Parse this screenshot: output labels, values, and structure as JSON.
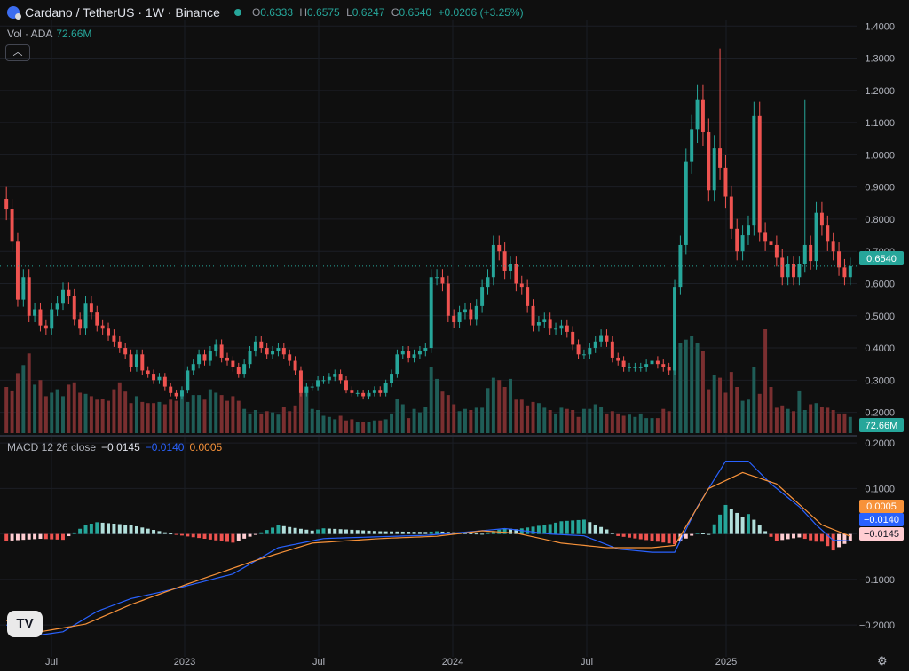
{
  "header": {
    "title": "Cardano / TetherUS · 1W · Binance",
    "o_label": "O",
    "o": "0.6333",
    "h_label": "H",
    "h": "0.6575",
    "l_label": "L",
    "l": "0.6247",
    "c_label": "C",
    "c": "0.6540",
    "change": "+0.0206 (+3.25%)"
  },
  "volume_legend": {
    "label": "Vol · ADA",
    "value": "72.66M"
  },
  "macd_legend": {
    "label": "MACD 12 26 close",
    "macd": "−0.0145",
    "signal": "−0.0140",
    "hist": "0.0005"
  },
  "badges": {
    "price": "0.6540",
    "volume": "72.66M",
    "macd_hist": "0.0005",
    "macd_signal": "−0.0140",
    "macd": "−0.0145"
  },
  "colors": {
    "up": "#26a69a",
    "down": "#ef5350",
    "vol_up": "#1f5d57",
    "vol_down": "#7a2f30",
    "macd_line": "#2962ff",
    "signal_line": "#f7923a",
    "hist_up_strong": "#26a69a",
    "hist_up_weak": "#b2dfdb",
    "hist_down_strong": "#ef5350",
    "hist_down_weak": "#ffcdd2",
    "bg": "#0f0f0f"
  },
  "chart_data": {
    "type": "candlestick",
    "interval": "1W",
    "x_labels": [
      "Jul",
      "2023",
      "Jul",
      "2024",
      "Jul",
      "2025"
    ],
    "price_axis": [
      "1.4000",
      "1.3000",
      "1.2000",
      "1.1000",
      "1.0000",
      "0.9000",
      "0.8000",
      "0.7000",
      "0.6000",
      "0.5000",
      "0.4000",
      "0.3000",
      "0.2000"
    ],
    "price_range": [
      0.13,
      1.42
    ],
    "last_price": 0.654,
    "macd_axis": [
      "0.2000",
      "0.1000",
      "0.0000",
      "−0.1000",
      "−0.2000"
    ],
    "macd_range": [
      -0.27,
      0.21
    ],
    "closes": [
      0.83,
      0.73,
      0.55,
      0.62,
      0.5,
      0.52,
      0.47,
      0.46,
      0.52,
      0.54,
      0.58,
      0.56,
      0.49,
      0.46,
      0.54,
      0.51,
      0.47,
      0.46,
      0.44,
      0.42,
      0.4,
      0.38,
      0.34,
      0.38,
      0.33,
      0.32,
      0.3,
      0.31,
      0.28,
      0.26,
      0.25,
      0.27,
      0.33,
      0.35,
      0.38,
      0.36,
      0.39,
      0.41,
      0.37,
      0.36,
      0.34,
      0.32,
      0.35,
      0.39,
      0.42,
      0.4,
      0.38,
      0.39,
      0.4,
      0.38,
      0.36,
      0.33,
      0.26,
      0.28,
      0.28,
      0.3,
      0.3,
      0.31,
      0.32,
      0.3,
      0.27,
      0.26,
      0.26,
      0.25,
      0.26,
      0.27,
      0.26,
      0.29,
      0.32,
      0.38,
      0.39,
      0.37,
      0.38,
      0.39,
      0.4,
      0.62,
      0.62,
      0.6,
      0.5,
      0.48,
      0.51,
      0.52,
      0.49,
      0.53,
      0.59,
      0.62,
      0.72,
      0.7,
      0.64,
      0.66,
      0.6,
      0.59,
      0.53,
      0.47,
      0.48,
      0.49,
      0.46,
      0.46,
      0.47,
      0.45,
      0.41,
      0.38,
      0.38,
      0.4,
      0.42,
      0.44,
      0.42,
      0.37,
      0.36,
      0.34,
      0.34,
      0.34,
      0.34,
      0.35,
      0.36,
      0.35,
      0.34,
      0.33,
      0.59,
      0.72,
      0.98,
      1.08,
      1.17,
      1.07,
      0.89,
      1.02,
      0.96,
      0.87,
      0.77,
      0.7,
      0.75,
      0.78,
      1.12,
      0.76,
      0.73,
      0.72,
      0.68,
      0.62,
      0.66,
      0.62,
      0.66,
      0.72,
      0.67,
      0.82,
      0.78,
      0.73,
      0.7,
      0.65,
      0.62,
      0.654
    ],
    "highs_note": "notable wicks: 0.90 at start, 1.33 in Dec 2024, 1.17 in Mar 2025",
    "volume_relative": [
      0.4,
      0.37,
      0.52,
      0.59,
      0.69,
      0.42,
      0.46,
      0.32,
      0.35,
      0.38,
      0.32,
      0.42,
      0.44,
      0.35,
      0.34,
      0.32,
      0.29,
      0.3,
      0.28,
      0.38,
      0.44,
      0.36,
      0.26,
      0.32,
      0.27,
      0.26,
      0.26,
      0.27,
      0.25,
      0.29,
      0.28,
      0.34,
      0.27,
      0.33,
      0.33,
      0.29,
      0.38,
      0.35,
      0.33,
      0.28,
      0.32,
      0.28,
      0.21,
      0.17,
      0.2,
      0.17,
      0.19,
      0.18,
      0.16,
      0.23,
      0.19,
      0.24,
      0.41,
      0.38,
      0.21,
      0.2,
      0.15,
      0.14,
      0.12,
      0.15,
      0.11,
      0.12,
      0.1,
      0.1,
      0.1,
      0.11,
      0.11,
      0.12,
      0.17,
      0.3,
      0.25,
      0.13,
      0.21,
      0.18,
      0.23,
      0.57,
      0.47,
      0.36,
      0.33,
      0.25,
      0.19,
      0.21,
      0.2,
      0.22,
      0.22,
      0.39,
      0.48,
      0.46,
      0.4,
      0.47,
      0.29,
      0.29,
      0.24,
      0.27,
      0.26,
      0.22,
      0.2,
      0.17,
      0.22,
      0.21,
      0.2,
      0.14,
      0.21,
      0.21,
      0.25,
      0.23,
      0.17,
      0.19,
      0.17,
      0.15,
      0.16,
      0.14,
      0.17,
      0.13,
      0.13,
      0.13,
      0.21,
      0.19,
      0.63,
      0.78,
      0.81,
      0.84,
      0.78,
      0.71,
      0.38,
      0.5,
      0.48,
      0.35,
      0.53,
      0.4,
      0.28,
      0.29,
      0.57,
      0.34,
      0.9,
      0.4,
      0.22,
      0.24,
      0.21,
      0.19,
      0.37,
      0.2,
      0.25,
      0.26,
      0.23,
      0.22,
      0.2,
      0.17,
      0.17,
      0.14
    ],
    "macd_line_points": [
      [
        0,
        -0.2
      ],
      [
        6,
        -0.222
      ],
      [
        10,
        -0.215
      ],
      [
        16,
        -0.17
      ],
      [
        22,
        -0.142
      ],
      [
        30,
        -0.12
      ],
      [
        40,
        -0.088
      ],
      [
        48,
        -0.03
      ],
      [
        56,
        -0.01
      ],
      [
        66,
        -0.006
      ],
      [
        74,
        -0.003
      ],
      [
        82,
        0.005
      ],
      [
        88,
        0.012
      ],
      [
        96,
        0.0
      ],
      [
        102,
        -0.004
      ],
      [
        108,
        -0.033
      ],
      [
        114,
        -0.04
      ],
      [
        118,
        -0.04
      ],
      [
        122,
        0.06
      ],
      [
        127,
        0.16
      ],
      [
        131,
        0.16
      ],
      [
        135,
        0.11
      ],
      [
        140,
        0.06
      ],
      [
        143,
        0.02
      ],
      [
        146,
        -0.014
      ],
      [
        150,
        -0.015
      ],
      [
        153,
        -0.014
      ]
    ],
    "signal_line_points": [
      [
        0,
        -0.19
      ],
      [
        6,
        -0.215
      ],
      [
        14,
        -0.198
      ],
      [
        22,
        -0.155
      ],
      [
        32,
        -0.11
      ],
      [
        44,
        -0.058
      ],
      [
        54,
        -0.02
      ],
      [
        66,
        -0.01
      ],
      [
        76,
        -0.005
      ],
      [
        84,
        0.007
      ],
      [
        90,
        0.002
      ],
      [
        98,
        -0.02
      ],
      [
        106,
        -0.03
      ],
      [
        114,
        -0.03
      ],
      [
        118,
        -0.025
      ],
      [
        124,
        0.1
      ],
      [
        130,
        0.135
      ],
      [
        136,
        0.11
      ],
      [
        144,
        0.02
      ],
      [
        150,
        -0.01
      ],
      [
        153,
        -0.0145
      ]
    ]
  }
}
